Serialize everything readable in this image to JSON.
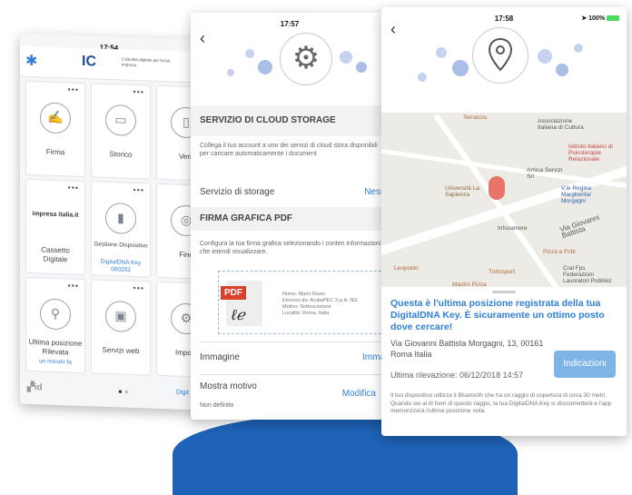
{
  "phone1": {
    "time": "17:54",
    "brand": "IC",
    "brand_tagline": "L'identità digitale per la tua impresa",
    "tiles": [
      {
        "label": "Firma",
        "sub": ""
      },
      {
        "label": "Storico",
        "sub": ""
      },
      {
        "label": "Verif",
        "sub": ""
      },
      {
        "label": "Cassetto Digitale",
        "sub": "",
        "logo": "impresa italia.it"
      },
      {
        "label": "Gestione Dispositivo",
        "sub": "DigitalDNA Key 000202"
      },
      {
        "label": "Find",
        "sub": ""
      },
      {
        "label": "Ultima posizione Rilevata",
        "sub": "un minuto fa"
      },
      {
        "label": "Servizi web",
        "sub": ""
      },
      {
        "label": "Impost",
        "sub": ""
      }
    ],
    "footer_logo": "id",
    "footer_link": "Digit"
  },
  "phone2": {
    "time": "17:57",
    "cloud_title": "SERVIZIO DI CLOUD STORAGE",
    "cloud_desc": "Collega il tuo account a uno dei servizi di cloud stora disponibili per caricare automaticamente i document",
    "storage_label": "Servizio di storage",
    "storage_value": "Ness",
    "sign_title": "FIRMA GRAFICA PDF",
    "sign_desc": "Configura la tua firma grafica selezionando i conten informazioni che intendi visualizzare.",
    "pdf_label": "PDF",
    "pdf_meta": [
      "Nome: Mario Rossi",
      "Emesso da: ArubaPEC S.p.A. NG",
      "Motivo: Sottoscrizione",
      "Località: Roma, Italia"
    ],
    "image_label": "Immagine",
    "image_value": "Imma",
    "motivo_label": "Mostra motivo",
    "motivo_value": "Modifica",
    "motivo_sub": "Non definito"
  },
  "phone3": {
    "time": "17:58",
    "battery": "100%",
    "map_labels": [
      "Terracciu",
      "Associazione Italiana di Cultura",
      "Istituto Italiano di Psicoterapia Relazionale",
      "Università La Sapienza",
      "Amica Servizi Srl",
      "V.le Regina Margherita/ Morgagni",
      "Infocamere",
      "Via Giovanni Battista",
      "Pizza e Fritti",
      "Leopoldo",
      "Tuttosport",
      "Mastro Pizza",
      "Cral Fps Federazioni Lavoratori Pubblici"
    ],
    "headline": "Questa è l'ultima posizione registrata della tua DigitalDNA Key.  È sicuramente un ottimo posto dove cercare!",
    "address": "Via Giovanni Battista Morgagni, 13, 00161 Roma Italia",
    "button_label": "Indicazioni",
    "last_seen": "Ultima rilevazione: 06/12/2018 14:57",
    "footnote": "Il tuo dispositivo utilizza il Bluetooth che ha un raggio di copertura di circa 30 metri. Quando sei al di fuori di questo raggio, la tua DigitalDNA Key si disconnetterà e l'app memorizzerà l'ultima posizione nota."
  },
  "colors": {
    "accent": "#2e7fd6",
    "blob": "#1f63b8",
    "button": "#7fb5e6"
  }
}
